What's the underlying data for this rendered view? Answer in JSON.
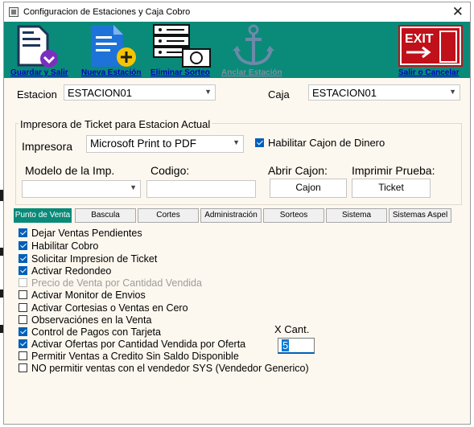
{
  "window": {
    "title": "Configuracion de Estaciones y Caja Cobro",
    "close_glyph": "✕"
  },
  "toolbar": {
    "save_label": "Guardar y Salir",
    "new_label": "Nueva Estación",
    "delete_label": "Eliminar Sorteo",
    "anchor_label": "Anclar Estación",
    "exit_label": "Salir o Cancelar",
    "exit_sign_text": "EXIT"
  },
  "station": {
    "estacion_label": "Estacion",
    "estacion_value": "ESTACION01",
    "caja_label": "Caja",
    "caja_value": "ESTACION01"
  },
  "printer": {
    "group_title": "Impresora de Ticket para Estacion Actual",
    "impresora_label": "Impresora",
    "impresora_value": "Microsoft Print to PDF",
    "cajon_checkbox_label": "Habilitar Cajon de Dinero",
    "cajon_checked": true,
    "modelo_label": "Modelo de la Imp.",
    "modelo_value": "",
    "codigo_label": "Codigo:",
    "codigo_value": "",
    "abrir_label": "Abrir Cajon:",
    "imprimir_label": "Imprimir Prueba:",
    "cajon_button": "Cajon",
    "ticket_button": "Ticket"
  },
  "tabs": [
    {
      "label": "Punto de Venta",
      "active": true
    },
    {
      "label": "Bascula",
      "active": false
    },
    {
      "label": "Cortes",
      "active": false
    },
    {
      "label": "Administración",
      "active": false
    },
    {
      "label": "Sorteos",
      "active": false
    },
    {
      "label": "Sistema",
      "active": false
    },
    {
      "label": "Sistemas Aspel",
      "active": false
    }
  ],
  "options": [
    {
      "label": "Dejar Ventas Pendientes",
      "checked": true,
      "disabled": false
    },
    {
      "label": "Habilitar Cobro",
      "checked": true,
      "disabled": false
    },
    {
      "label": "Solicitar Impresion de Ticket",
      "checked": true,
      "disabled": false
    },
    {
      "label": "Activar Redondeo",
      "checked": true,
      "disabled": false
    },
    {
      "label": "Precio de Venta por Cantidad Vendida",
      "checked": false,
      "disabled": true
    },
    {
      "label": "Activar Monitor de Envios",
      "checked": false,
      "disabled": false
    },
    {
      "label": "Activar Cortesias o Ventas en Cero",
      "checked": false,
      "disabled": false
    },
    {
      "label": "Observaciónes en la Venta",
      "checked": false,
      "disabled": false
    },
    {
      "label": "Control de Pagos con Tarjeta",
      "checked": true,
      "disabled": false
    },
    {
      "label": "Activar Ofertas por Cantidad Vendida por Oferta",
      "checked": true,
      "disabled": false
    },
    {
      "label": "Permitir Ventas a Credito Sin Saldo Disponible",
      "checked": false,
      "disabled": false
    },
    {
      "label": "NO permitir ventas con el vendedor SYS (Vendedor Generico)",
      "checked": false,
      "disabled": false
    }
  ],
  "xcant": {
    "label": "X Cant.",
    "value": "5"
  },
  "colors": {
    "toolbar_bg": "#0a8a79",
    "link_blue": "#0000c8",
    "check_blue": "#005fb8",
    "window_bg": "#fdf8ef"
  }
}
